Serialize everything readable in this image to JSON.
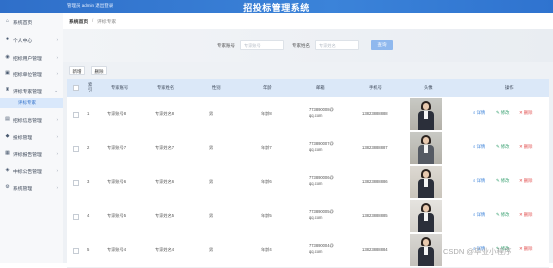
{
  "header": {
    "user_text": "管理员 admin  退出登录",
    "title": "招投标管理系统",
    "bg_color": "#3378d1"
  },
  "sidebar": {
    "items": [
      {
        "label": "系统首页",
        "icon": "home-icon"
      },
      {
        "label": "个人中心",
        "icon": "user-icon"
      },
      {
        "label": "招标用户管理",
        "icon": "users-icon"
      },
      {
        "label": "招标单位管理",
        "icon": "building-icon"
      },
      {
        "label": "评标专家管理",
        "icon": "expert-icon",
        "expanded": true
      },
      {
        "label": "招标信息管理",
        "icon": "doc-icon"
      },
      {
        "label": "投标管理",
        "icon": "bid-icon"
      },
      {
        "label": "评标报告管理",
        "icon": "report-icon"
      },
      {
        "label": "中标公告管理",
        "icon": "notice-icon"
      },
      {
        "label": "系统管理",
        "icon": "gear-icon"
      }
    ],
    "active_sub": "评标专家"
  },
  "breadcrumb": {
    "home": "系统首页",
    "separator": "/",
    "current": "评标专家"
  },
  "search": {
    "fields": [
      {
        "label": "专家账号",
        "placeholder": "专家账号"
      },
      {
        "label": "专家姓名",
        "placeholder": "专家姓名"
      }
    ],
    "button": "查询"
  },
  "actions": {
    "add": "新增",
    "delete": "删除"
  },
  "table": {
    "columns": [
      "索引",
      "专家账号",
      "专家姓名",
      "性别",
      "年龄",
      "邮箱",
      "手机号",
      "头像",
      "操作"
    ],
    "rows": [
      {
        "index": "1",
        "account": "专家账号8",
        "name": "专家姓名8",
        "gender": "男",
        "age": "年龄8",
        "email": "773890008@qq.com",
        "phone": "13823888888"
      },
      {
        "index": "2",
        "account": "专家账号7",
        "name": "专家姓名7",
        "gender": "男",
        "age": "年龄7",
        "email": "773890007@qq.com",
        "phone": "13823888887"
      },
      {
        "index": "3",
        "account": "专家账号6",
        "name": "专家姓名6",
        "gender": "男",
        "age": "年龄6",
        "email": "773890006@qq.com",
        "phone": "13823888886"
      },
      {
        "index": "4",
        "account": "专家账号5",
        "name": "专家姓名5",
        "gender": "男",
        "age": "年龄5",
        "email": "773890005@qq.com",
        "phone": "13823888885"
      },
      {
        "index": "5",
        "account": "专家账号4",
        "name": "专家姓名4",
        "gender": "男",
        "age": "年龄4",
        "email": "773890004@qq.com",
        "phone": "13823888884"
      }
    ],
    "ops": {
      "detail": "详情",
      "edit": "修改",
      "delete": "删除"
    }
  },
  "watermark": "CSDN @毕业小程序"
}
